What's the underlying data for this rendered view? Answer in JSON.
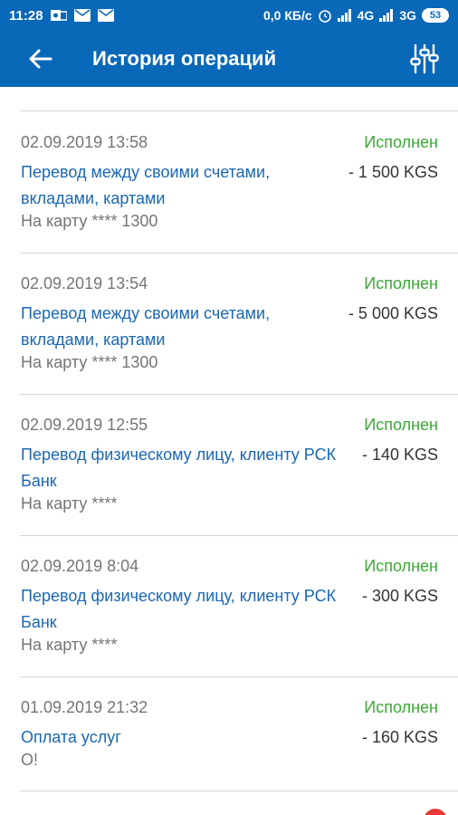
{
  "status_bar": {
    "time": "11:28",
    "speed": "0,0 КБ/с",
    "network1": "4G",
    "network2": "3G",
    "battery": "53"
  },
  "header": {
    "title": "История операций"
  },
  "operations": [
    {
      "date": "02.09.2019 13:58",
      "status": "Исполнен",
      "name": "Перевод между своими счетами, вкладами, картами",
      "amount": "- 1 500 KGS",
      "detail": "На карту **** 1300"
    },
    {
      "date": "02.09.2019 13:54",
      "status": "Исполнен",
      "name": "Перевод между своими счетами, вкладами, картами",
      "amount": "- 5 000 KGS",
      "detail": "На карту **** 1300"
    },
    {
      "date": "02.09.2019 12:55",
      "status": "Исполнен",
      "name": "Перевод физическому лицу, клиенту РСК Банк",
      "amount": "- 140 KGS",
      "detail": "На карту ****"
    },
    {
      "date": "02.09.2019 8:04",
      "status": "Исполнен",
      "name": "Перевод физическому лицу, клиенту РСК Банк",
      "amount": "- 300 KGS",
      "detail": "На карту ****"
    },
    {
      "date": "01.09.2019 21:32",
      "status": "Исполнен",
      "name": "Оплата услуг",
      "amount": "- 160 KGS",
      "detail": "О!"
    }
  ],
  "colors": {
    "primary": "#0a68b8",
    "status_ok": "#3aa935",
    "link": "#1a67b5"
  }
}
